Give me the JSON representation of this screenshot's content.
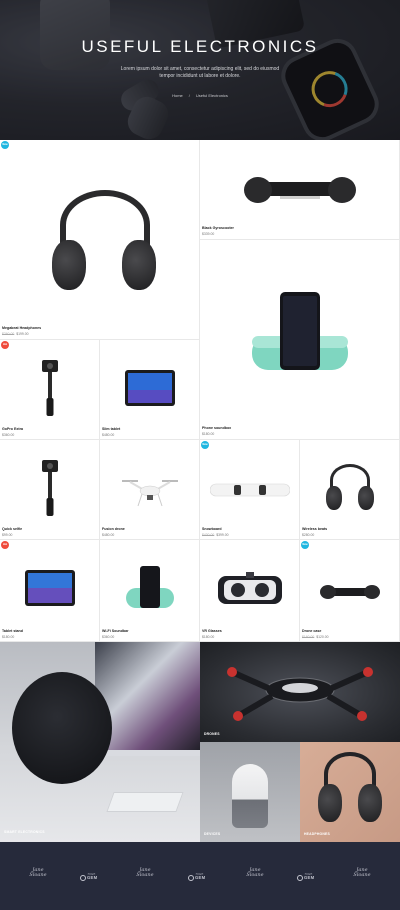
{
  "hero": {
    "title": "USEFUL ELECTRONICS",
    "subtitle": "Lorem ipsum dolor sit amet, consectetur adipiscing elit, sed do eiusmod tempor incididunt ut labore et dolore.",
    "breadcrumb_home": "Home",
    "breadcrumb_sep": "/",
    "breadcrumb_current": "Useful Electronics"
  },
  "products": [
    {
      "name": "Megabeat Headphones",
      "old_price": "$260.00",
      "price": "$199.00",
      "badge": "New",
      "badge_color": "#1fb6e0"
    },
    {
      "name": "Black Gyroscooter",
      "price": "$339.00"
    },
    {
      "name": "GoPro Extra",
      "price": "$360.00",
      "badge": "Hot",
      "badge_color": "#ef4b3c"
    },
    {
      "name": "Slim tablet",
      "price": "$480.00"
    },
    {
      "name": "Phone soundbox",
      "price": "$180.00"
    },
    {
      "name": "Quick selfie",
      "price": "$99.00"
    },
    {
      "name": "Fusion drone",
      "price": "$480.00"
    },
    {
      "name": "Snowboard",
      "old_price": "$430.00",
      "price": "$399.00",
      "badge": "New",
      "badge_color": "#1fb6e0"
    },
    {
      "name": "Wireless beats",
      "price": "$280.00"
    },
    {
      "name": "Tablet stand",
      "price": "$180.00",
      "badge": "Hot",
      "badge_color": "#ef4b3c"
    },
    {
      "name": "Wi-Fi Soundbar",
      "price": "$360.00"
    },
    {
      "name": "VR Glasses",
      "price": "$180.00"
    },
    {
      "name": "Drone case",
      "old_price": "$160.00",
      "price": "$120.00",
      "badge": "New",
      "badge_color": "#1fb6e0"
    }
  ],
  "collage": {
    "smart": "SMART ELECTRONICS",
    "drones": "DRONES",
    "devices": "DEVICES",
    "headphones": "HEADPHONES"
  },
  "brands": {
    "script_line1": "Jane",
    "script_line2": "Sloane",
    "gem_top": "HIGH",
    "gem": "GEM"
  }
}
